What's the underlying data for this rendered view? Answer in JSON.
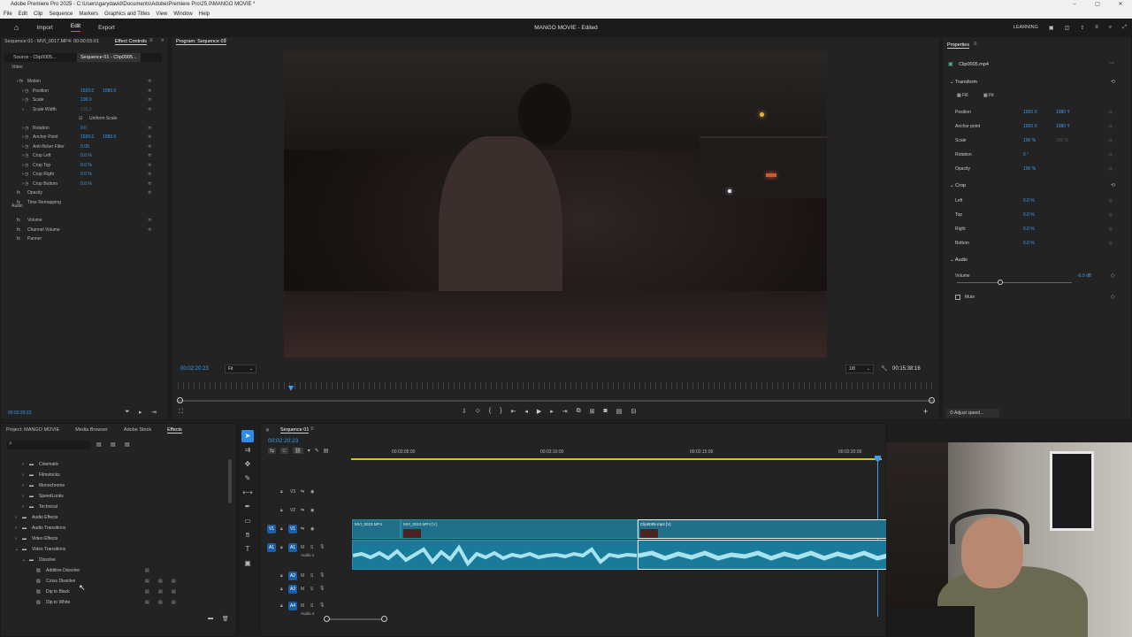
{
  "titlebar": {
    "title": "Adobe Premiere Pro 2025 - C:\\Users\\garydavid\\Documents\\Adobe\\Premiere Pro\\25.0\\MANGO MOVIE *"
  },
  "menubar": [
    "File",
    "Edit",
    "Clip",
    "Sequence",
    "Markers",
    "Graphics and Titles",
    "View",
    "Window",
    "Help"
  ],
  "header": {
    "tabs": [
      "Import",
      "Edit",
      "Export"
    ],
    "active_tab": "Edit",
    "project_title": "MANGO MOVIE - Edited",
    "learning": "LEARNING"
  },
  "effect_controls": {
    "source_label": "Sequence 01 : MVI_0017.MP4: 00:00:55:01",
    "tab": "Effect Controls",
    "subtabs": [
      "Source - Clip0005...",
      "Sequence 01 - Clip0005..."
    ],
    "sections": {
      "video": "Video",
      "audio": "Audio"
    },
    "rows": [
      {
        "label": "Motion",
        "v1": "",
        "v2": ""
      },
      {
        "label": "Position",
        "v1": "1920.0",
        "v2": "1080.0"
      },
      {
        "label": "Scale",
        "v1": "100.0",
        "v2": ""
      },
      {
        "label": "Scale Width",
        "v1": "100.0",
        "v2": ""
      },
      {
        "label": "Uniform Scale",
        "v1": "",
        "v2": ""
      },
      {
        "label": "Rotation",
        "v1": "0.0",
        "v2": ""
      },
      {
        "label": "Anchor Point",
        "v1": "1920.0",
        "v2": "1080.0"
      },
      {
        "label": "Anti-flicker Filter",
        "v1": "0.00",
        "v2": ""
      },
      {
        "label": "Crop Left",
        "v1": "0.0 %",
        "v2": ""
      },
      {
        "label": "Crop Top",
        "v1": "0.0 %",
        "v2": ""
      },
      {
        "label": "Crop Right",
        "v1": "0.0 %",
        "v2": ""
      },
      {
        "label": "Crop Bottom",
        "v1": "0.0 %",
        "v2": ""
      },
      {
        "label": "Opacity",
        "v1": "",
        "v2": ""
      },
      {
        "label": "Time Remapping",
        "v1": "",
        "v2": ""
      },
      {
        "label": "Volume",
        "v1": "",
        "v2": ""
      },
      {
        "label": "Channel Volume",
        "v1": "",
        "v2": ""
      },
      {
        "label": "Panner",
        "v1": "",
        "v2": ""
      }
    ],
    "timecode": "00:02:20:23"
  },
  "program": {
    "title": "Program: Sequence 01",
    "timecode": "00:02:20:23",
    "fit": "Fit",
    "resolution": "1/8",
    "duration": "00:15:38:16"
  },
  "properties": {
    "title": "Properties",
    "clip": "Clip0005.mp4",
    "transform": "Transform",
    "fill": "Fill",
    "fit": "Fit",
    "rows": [
      {
        "label": "Position",
        "v1": "1920 X",
        "v2": "1080 Y"
      },
      {
        "label": "Anchor point",
        "v1": "1920 X",
        "v2": "1080 Y"
      },
      {
        "label": "Scale",
        "v1": "100 %",
        "v2": "100 %"
      },
      {
        "label": "Rotation",
        "v1": "0 °",
        "v2": ""
      },
      {
        "label": "Opacity",
        "v1": "100 %",
        "v2": ""
      }
    ],
    "crop": "Crop",
    "crop_rows": [
      {
        "label": "Left",
        "v1": "0.0 %"
      },
      {
        "label": "Top",
        "v1": "0.0 %"
      },
      {
        "label": "Right",
        "v1": "0.0 %"
      },
      {
        "label": "Bottom",
        "v1": "0.0 %"
      }
    ],
    "audio": "Audio",
    "volume_label": "Volume",
    "volume_value": "-6.9 dB",
    "volume_level": 0.38,
    "mute": "Mute",
    "adjust_speed": "Adjust speed..."
  },
  "project": {
    "tabs": [
      "Project: MANGO MOVIE",
      "Media Browser",
      "Adobe Stock",
      "Effects"
    ],
    "active_tab": "Effects",
    "items": [
      {
        "label": "Cinematic",
        "indent": 1,
        "type": "folder"
      },
      {
        "label": "Filmstocks",
        "indent": 1,
        "type": "folder"
      },
      {
        "label": "Monochrome",
        "indent": 1,
        "type": "folder"
      },
      {
        "label": "SpeedLooks",
        "indent": 1,
        "type": "folder"
      },
      {
        "label": "Technical",
        "indent": 1,
        "type": "folder"
      },
      {
        "label": "Audio Effects",
        "indent": 0,
        "type": "folder"
      },
      {
        "label": "Audio Transitions",
        "indent": 0,
        "type": "folder"
      },
      {
        "label": "Video Effects",
        "indent": 0,
        "type": "folder"
      },
      {
        "label": "Video Transitions",
        "indent": 0,
        "type": "folder-open"
      },
      {
        "label": "Dissolve",
        "indent": 1,
        "type": "folder-open"
      },
      {
        "label": "Additive Dissolve",
        "indent": 2,
        "type": "effect"
      },
      {
        "label": "Cross Dissolve",
        "indent": 2,
        "type": "effect"
      },
      {
        "label": "Dip to Black",
        "indent": 2,
        "type": "effect"
      },
      {
        "label": "Dip to White",
        "indent": 2,
        "type": "effect"
      }
    ]
  },
  "timeline": {
    "tab": "Sequence 01",
    "timecode": "00:02:20:23",
    "ruler": [
      "00:02:05:00",
      "00:02:10:00",
      "00:02:15:00",
      "00:02:20:00"
    ],
    "tracks": [
      "V3",
      "V2",
      "V1",
      "A1",
      "A2",
      "A3",
      "A4"
    ],
    "a1_name": "Audio 1",
    "a4_name": "Audio 4",
    "clips": [
      {
        "label": "MVI_0023.MP4"
      },
      {
        "label": "MVI_0023.MP4 [V]"
      },
      {
        "label": "Clip0005.mp4 [V]"
      }
    ]
  }
}
